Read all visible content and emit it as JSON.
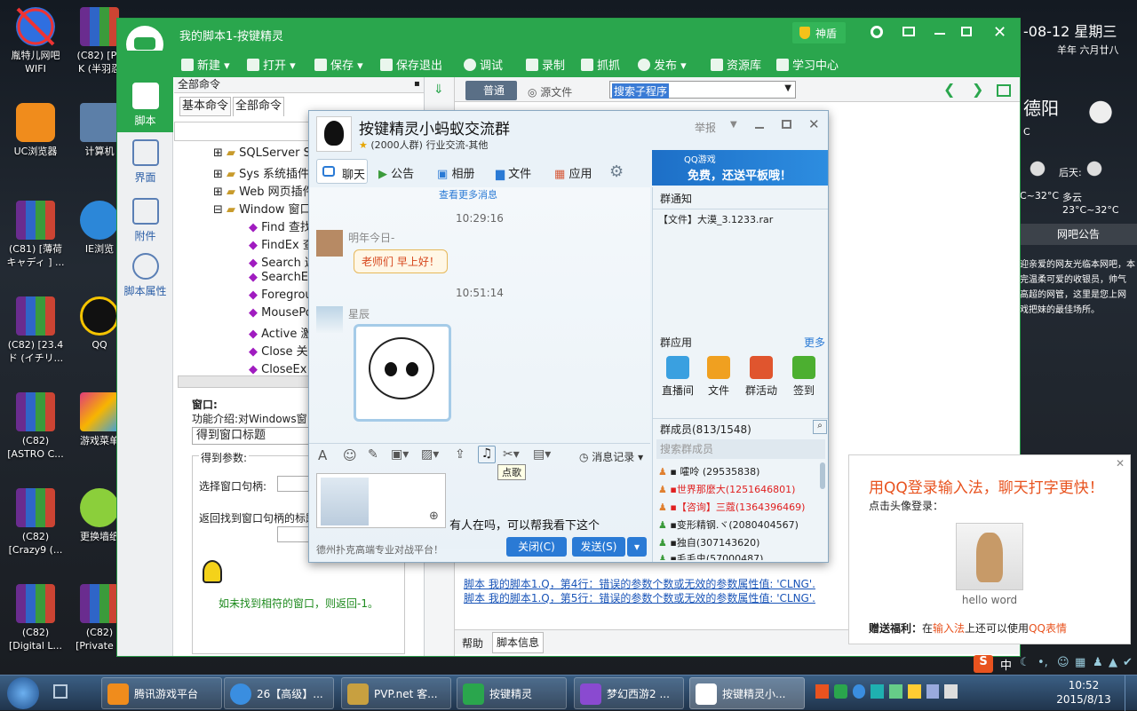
{
  "desktop": {
    "icons": [
      {
        "label": "胤特儿网吧\nWIFI"
      },
      {
        "label": "(C82) [Pa\nK (半羽忍"
      },
      {
        "label": "UC浏览器"
      },
      {
        "label": "计算机"
      },
      {
        "label": "(C81) [薄荷\nキャディ ] ..."
      },
      {
        "label": "IE浏览"
      },
      {
        "label": "(C82) [23.4\nド (イチリ..."
      },
      {
        "label": "QQ"
      },
      {
        "label": "(C82)\n[ASTRO C..."
      },
      {
        "label": "游戏菜单"
      },
      {
        "label": "(C82)\n[Crazy9 (..."
      },
      {
        "label": "更换墙纸"
      },
      {
        "label": "(C82)\n[Digital L..."
      },
      {
        "label": "(C82)\n[Private C"
      }
    ],
    "weather": {
      "date": "-08-12 星期三",
      "lunar": "羊年 六月廿八",
      "city": "德阳",
      "unit": "C",
      "range1": "C~32°C",
      "day2_label": "后天:",
      "day2": "多云 23°C~32°C",
      "bar_title": "网吧公告",
      "notice": "迎亲爱的网友光临本网吧，本\n完温柔可爱的收银员，帅气\n高超的网管，这里是您上网\n戏把妹的最佳场所。"
    }
  },
  "main": {
    "title": "我的脚本1-按键精灵",
    "shield": "神盾",
    "toolbar": {
      "new": "新建",
      "open": "打开",
      "save": "保存",
      "save_exit": "保存退出",
      "debug": "调试",
      "record": "录制",
      "grab": "抓抓",
      "publish": "发布",
      "library": "资源库",
      "learn": "学习中心"
    },
    "nav": [
      {
        "label": "脚本"
      },
      {
        "label": "界面"
      },
      {
        "label": "附件"
      },
      {
        "label": "脚本属性"
      }
    ],
    "cmd": {
      "title": "全部命令",
      "tab_basic": "基本命令",
      "tab_all": "全部命令",
      "tree": [
        "SQLServer S",
        "Sys 系统插件",
        "Web 网页插件",
        "Window 窗口"
      ],
      "subitems": [
        "Find 查找",
        "FindEx 查",
        "Search 遍",
        "SearchEx",
        "Foregrou",
        "MousePo",
        "Active 激活",
        "Close 关闭",
        "CloseEx 关"
      ],
      "info": {
        "heading": "窗口:",
        "intro": "功能介绍:对Windows窗口",
        "select_val": "得到窗口标题",
        "params_label": "得到参数:",
        "param1": "选择窗口句柄:",
        "param2": "返回找到窗口句柄的标题",
        "warn": "如未找到相符的窗口，则返回-1。"
      }
    },
    "editor": {
      "tab_normal": "普通",
      "tab_source": "源文件",
      "search_value": "搜索子程序",
      "errors": [
        "脚本  我的脚本1.Q，第4行：错误的参数个数或无效的参数属性值: 'CLNG'.",
        "脚本  我的脚本1.Q，第5行：错误的参数个数或无效的参数属性值: 'CLNG'."
      ],
      "bottom_tabs": [
        "帮助",
        "脚本信息"
      ]
    }
  },
  "qq": {
    "group_name": "按键精灵小蚂蚁交流群",
    "group_meta": "(2000人群) 行业交流-其他",
    "report": "举报",
    "tabs": [
      "聊天",
      "公告",
      "相册",
      "文件",
      "应用"
    ],
    "ad_text": "免费，还送平板哦！",
    "ad_brand": "QQ游戏",
    "more_msgs": "查看更多消息",
    "messages": [
      {
        "time": "10:29:16",
        "sender": "明年今日-",
        "text": "老师们  早上好！"
      },
      {
        "time": "10:51:14",
        "sender": "星辰",
        "text": ""
      }
    ],
    "tooltip": "点歌",
    "msg_record": "消息记录",
    "input_text": "有人在吗，可以帮我看下这个",
    "footer_ad": "德州扑克高端专业对战平台！",
    "close_btn": "关闭(C)",
    "send_btn": "发送(S)",
    "notice_title": "群通知",
    "notice_item": "【文件】大漠_3.1233.rar",
    "apps_title": "群应用",
    "apps_more": "更多",
    "apps": [
      "直播间",
      "文件",
      "群活动",
      "签到"
    ],
    "members_title": "群成员(813/1548)",
    "member_search": "搜索群成员",
    "members": [
      "嚯呤  (29535838)",
      "世界那麼大(1251646801)",
      "【咨询】三蔻(1364396469)",
      "变形精钢.ヾ(2080404567)",
      "独自(307143620)",
      "毛毛虫(57000487)"
    ]
  },
  "ime": {
    "title": "用QQ登录输入法，聊天打字更快！",
    "subtitle": "点击头像登录：",
    "user": "hello word",
    "footer_prefix": "赠送福利：",
    "footer_mid1": "在",
    "footer_link1": "输入法",
    "footer_mid2": "上还可以使用",
    "footer_link2": "QQ表情"
  },
  "taskbar": {
    "tasks": [
      "腾讯游戏平台",
      "26【高级】...",
      "PVP.net 客...",
      "按键精灵",
      "梦幻西游2 ...",
      "按键精灵小..."
    ],
    "time": "10:52",
    "date": "2015/8/13",
    "ime_mark": "中"
  },
  "colors": {
    "green": "#2aa64d",
    "qq_blue": "#2a7ad5",
    "link": "#1a55b8",
    "ime_title": "#e8531f"
  }
}
